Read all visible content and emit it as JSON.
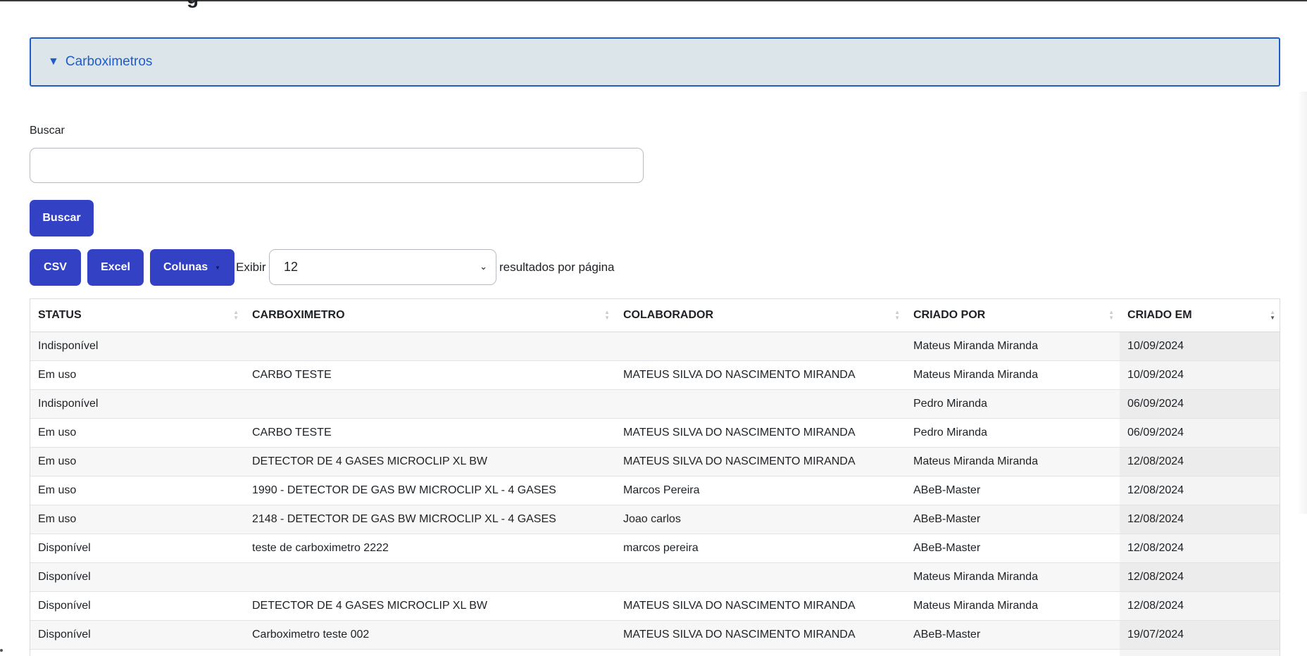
{
  "header": {
    "title_fragment": "g"
  },
  "collapse": {
    "title": "Carboximetros",
    "caret": "▼"
  },
  "search": {
    "label": "Buscar",
    "value": "",
    "placeholder": "",
    "button_label": "Buscar"
  },
  "toolbar": {
    "csv_label": "CSV",
    "excel_label": "Excel",
    "columns_label": "Colunas",
    "show_label": "Exibir",
    "page_size": "12",
    "per_page_label": "resultados por página"
  },
  "table": {
    "columns": [
      "STATUS",
      "CARBOXIMETRO",
      "COLABORADOR",
      "CRIADO POR",
      "CRIADO EM"
    ],
    "sorted_column": "CRIADO EM",
    "sort_direction": "desc",
    "rows": [
      [
        "Indisponível",
        "",
        "",
        "Mateus Miranda Miranda",
        "10/09/2024"
      ],
      [
        "Em uso",
        "CARBO TESTE",
        "MATEUS SILVA DO NASCIMENTO MIRANDA",
        "Mateus Miranda Miranda",
        "10/09/2024"
      ],
      [
        "Indisponível",
        "",
        "",
        "Pedro Miranda",
        "06/09/2024"
      ],
      [
        "Em uso",
        "CARBO TESTE",
        "MATEUS SILVA DO NASCIMENTO MIRANDA",
        "Pedro Miranda",
        "06/09/2024"
      ],
      [
        "Em uso",
        "DETECTOR DE 4 GASES MICROCLIP XL BW",
        "MATEUS SILVA DO NASCIMENTO MIRANDA",
        "Mateus Miranda Miranda",
        "12/08/2024"
      ],
      [
        "Em uso",
        "1990 - DETECTOR DE GAS BW MICROCLIP XL - 4 GASES",
        "Marcos Pereira",
        "ABeB-Master",
        "12/08/2024"
      ],
      [
        "Em uso",
        "2148 - DETECTOR DE GAS BW MICROCLIP XL - 4 GASES",
        "Joao carlos",
        "ABeB-Master",
        "12/08/2024"
      ],
      [
        "Disponível",
        "teste de carboximetro 2222",
        "marcos pereira",
        "ABeB-Master",
        "12/08/2024"
      ],
      [
        "Disponível",
        "",
        "",
        "Mateus Miranda Miranda",
        "12/08/2024"
      ],
      [
        "Disponível",
        "DETECTOR DE 4 GASES MICROCLIP XL BW",
        "MATEUS SILVA DO NASCIMENTO MIRANDA",
        "Mateus Miranda Miranda",
        "12/08/2024"
      ],
      [
        "Disponível",
        "Carboximetro teste 002",
        "MATEUS SILVA DO NASCIMENTO MIRANDA",
        "ABeB-Master",
        "19/07/2024"
      ],
      [
        "",
        "",
        "",
        "",
        ""
      ]
    ]
  },
  "colors": {
    "accent": "#3342c4",
    "link": "#1f5cc7",
    "collapse_bg": "#dce5ea"
  },
  "icons": [
    "caret-down-icon",
    "sort-icon",
    "chevron-down-icon"
  ]
}
